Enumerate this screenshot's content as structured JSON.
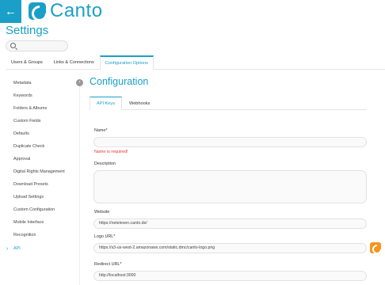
{
  "app": {
    "logo_text": "Canto",
    "back_icon": "arrow-left-icon",
    "accent": "#1aa0c8"
  },
  "page": {
    "title": "Settings"
  },
  "search": {
    "placeholder": ""
  },
  "top_tabs": [
    "Users & Groups",
    "Links & Connections",
    "Configuration Options"
  ],
  "sidebar": {
    "items": [
      "Metadata",
      "Keywords",
      "Folders & Albums",
      "Custom Fields",
      "Defaults",
      "Duplicate Check",
      "Approval",
      "Digital Rights Management",
      "Download Presets",
      "Upload Settings",
      "Custom Configuration",
      "Mobile Interface",
      "Recognition",
      "API"
    ],
    "active": "API"
  },
  "config": {
    "title": "Configuration",
    "tabs": [
      "API Keys",
      "Webhooks"
    ],
    "fields": {
      "name_label": "Name*",
      "name_value": "",
      "name_error": "Name is required!",
      "description_label": "Description",
      "website_label": "Website",
      "website_value": "https://neteleven.canto.de/",
      "logo_label": "Logo URL*",
      "logo_value": "https://s3-us-west-2.amazonaws.com/static.dmc/canto-logo.png",
      "redirect_label": "Redirect URL*",
      "redirect_value": "http://localhost:3000"
    },
    "error_color": "#e53935",
    "upload_color": "#f7941d"
  }
}
